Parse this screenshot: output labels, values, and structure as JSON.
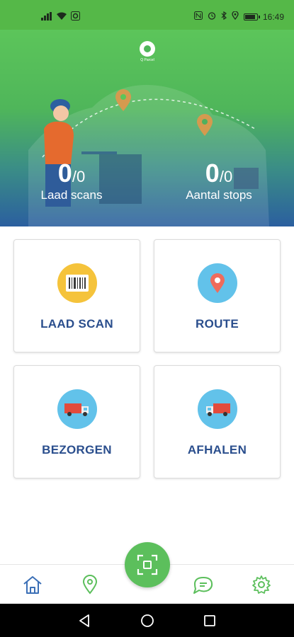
{
  "status_bar": {
    "time": "16:49",
    "left_icons": [
      "signal-icon",
      "wifi-icon",
      "app-notification-icon"
    ],
    "right_icons": [
      "nfc-icon",
      "alarm-icon",
      "bluetooth-icon",
      "location-icon",
      "battery-icon"
    ]
  },
  "header": {
    "logo_text": "Q Parcel",
    "stats": [
      {
        "value": "0",
        "total": "/0",
        "label": "Laad scans"
      },
      {
        "value": "0",
        "total": "/0",
        "label": "Aantal stops"
      }
    ]
  },
  "tiles": [
    {
      "label": "LAAD SCAN",
      "icon": "barcode-icon",
      "color": "#f5c33b"
    },
    {
      "label": "ROUTE",
      "icon": "map-pin-icon",
      "color": "#62c2ea"
    },
    {
      "label": "BEZORGEN",
      "icon": "delivery-truck-icon",
      "color": "#62c2ea"
    },
    {
      "label": "AFHALEN",
      "icon": "pickup-truck-icon",
      "color": "#62c2ea"
    }
  ],
  "bottom_nav": {
    "items": [
      "home-icon",
      "location-icon",
      "scan-icon",
      "chat-icon",
      "settings-icon"
    ],
    "accent": "#5cbf5c"
  },
  "system_nav": [
    "back-icon",
    "home-icon",
    "recents-icon"
  ],
  "colors": {
    "brand_green": "#55b848",
    "tile_text": "#2a4e8d",
    "hero_blue": "#2b5f9f"
  }
}
